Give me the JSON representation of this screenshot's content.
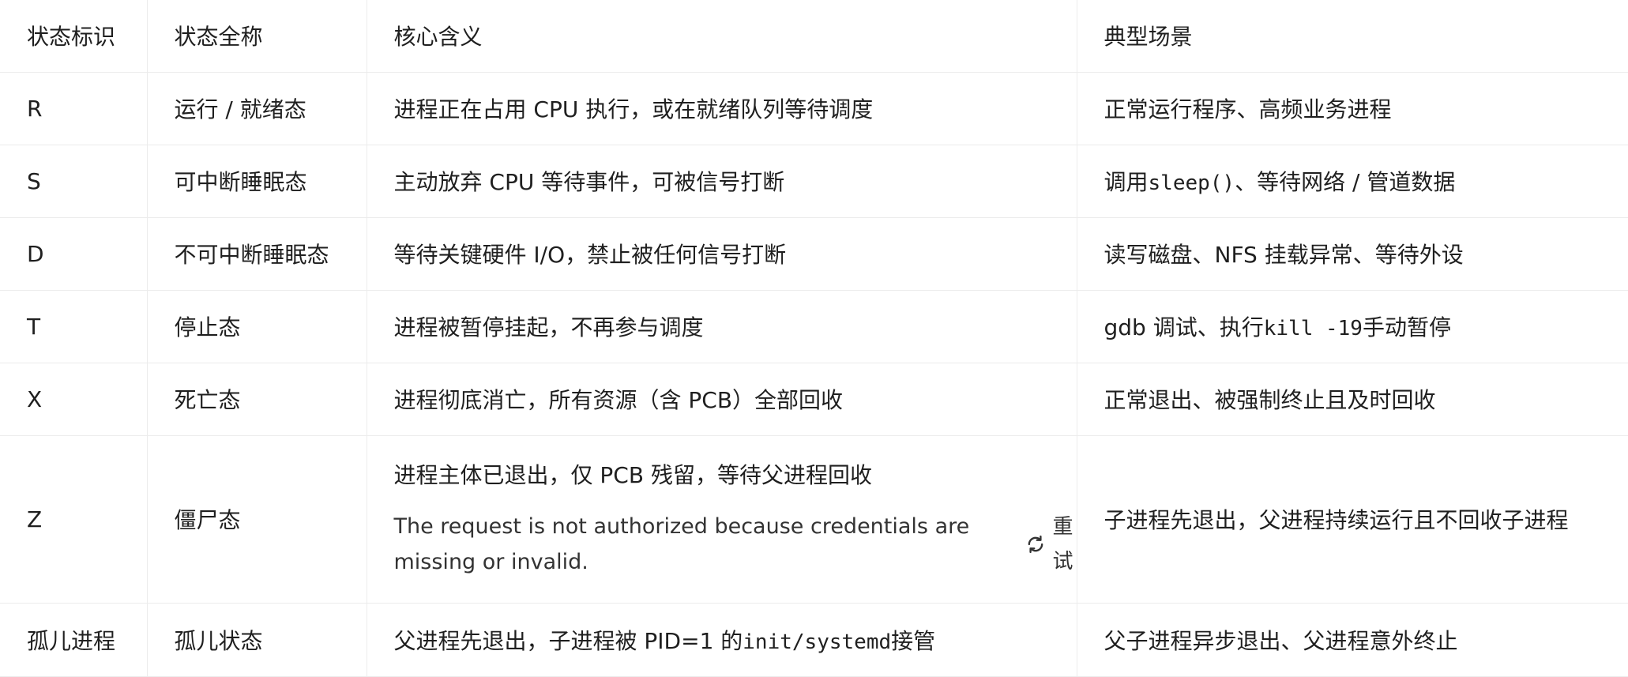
{
  "table": {
    "headers": [
      "状态标识",
      "状态全称",
      "核心含义",
      "典型场景"
    ],
    "rows": [
      {
        "id": "R",
        "name": "运行 / 就绪态",
        "meaning": "进程正在占用 CPU 执行，或在就绪队列等待调度",
        "scene": "正常运行程序、高频业务进程"
      },
      {
        "id": "S",
        "name": "可中断睡眠态",
        "meaning": "主动放弃 CPU 等待事件，可被信号打断",
        "scene_pre": "调用",
        "scene_code": "sleep()",
        "scene_post": "、等待网络 / 管道数据"
      },
      {
        "id": "D",
        "name": "不可中断睡眠态",
        "meaning": "等待关键硬件 I/O，禁止被任何信号打断",
        "scene": "读写磁盘、NFS 挂载异常、等待外设"
      },
      {
        "id": "T",
        "name": "停止态",
        "meaning": "进程被暂停挂起，不再参与调度",
        "scene_pre": "gdb 调试、执行",
        "scene_code": "kill -19",
        "scene_post": "手动暂停"
      },
      {
        "id": "X",
        "name": "死亡态",
        "meaning": "进程彻底消亡，所有资源（含 PCB）全部回收",
        "scene": "正常退出、被强制终止且及时回收"
      },
      {
        "id": "Z",
        "name": "僵尸态",
        "meaning": "进程主体已退出，仅 PCB 残留，等待父进程回收",
        "error": "The request is not authorized because credentials are missing or invalid.",
        "retry_label": "重试",
        "scene": "子进程先退出，父进程持续运行且不回收子进程"
      },
      {
        "id": "孤儿进程",
        "name": "孤儿状态",
        "meaning_pre": "父进程先退出，子进程被 PID=1 的",
        "meaning_code": "init/systemd",
        "meaning_post": "接管",
        "scene": "父子进程异步退出、父进程意外终止"
      }
    ]
  },
  "icons": {
    "retry": "refresh-icon"
  }
}
